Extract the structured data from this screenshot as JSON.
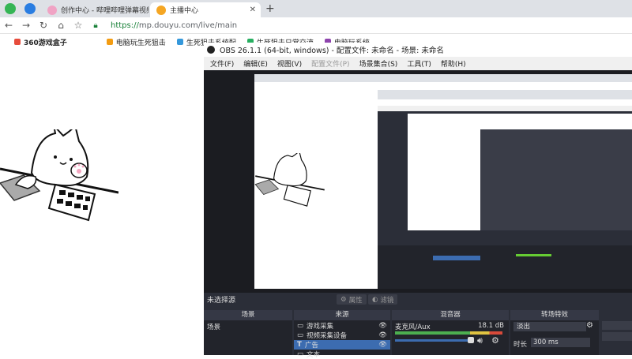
{
  "browser": {
    "tabs": [
      {
        "label": "创作中心 - 哔哩哔哩弹幕视频网",
        "active": false
      },
      {
        "label": "主播中心",
        "active": true
      }
    ],
    "url_scheme": "https://",
    "url_rest": "mp.douyu.com/live/main",
    "bookmarks": [
      "360游戏盒子",
      "电脑玩生死狙击",
      "生死狙击系统配",
      "生死狙击日常交流",
      "电脑玩系统"
    ]
  },
  "obs": {
    "title": "OBS 26.1.1 (64-bit, windows) - 配置文件: 未命名 - 场景: 未命名",
    "menu": [
      "文件(F)",
      "编辑(E)",
      "视图(V)",
      "配置文件(P)",
      "场景集合(S)",
      "工具(T)",
      "帮助(H)"
    ],
    "no_source_label": "未选择源",
    "properties_btn": "属性",
    "filters_btn": "滤镜",
    "docks": {
      "scenes": "场景",
      "sources": "来源",
      "mixer": "混音器",
      "transitions": "转场特效"
    },
    "scene_items": [
      "场景"
    ],
    "source_items": [
      {
        "label": "游戏采集",
        "selected": false
      },
      {
        "label": "视频采集设备",
        "selected": false
      },
      {
        "label": "广告",
        "selected": true
      },
      {
        "label": "文本",
        "selected": false
      }
    ],
    "mixer": {
      "channel": "麦克风/Aux",
      "level": "18.1 dB"
    },
    "transition": {
      "type": "淡出",
      "duration_label": "时长",
      "duration_value": "300 ms"
    }
  }
}
